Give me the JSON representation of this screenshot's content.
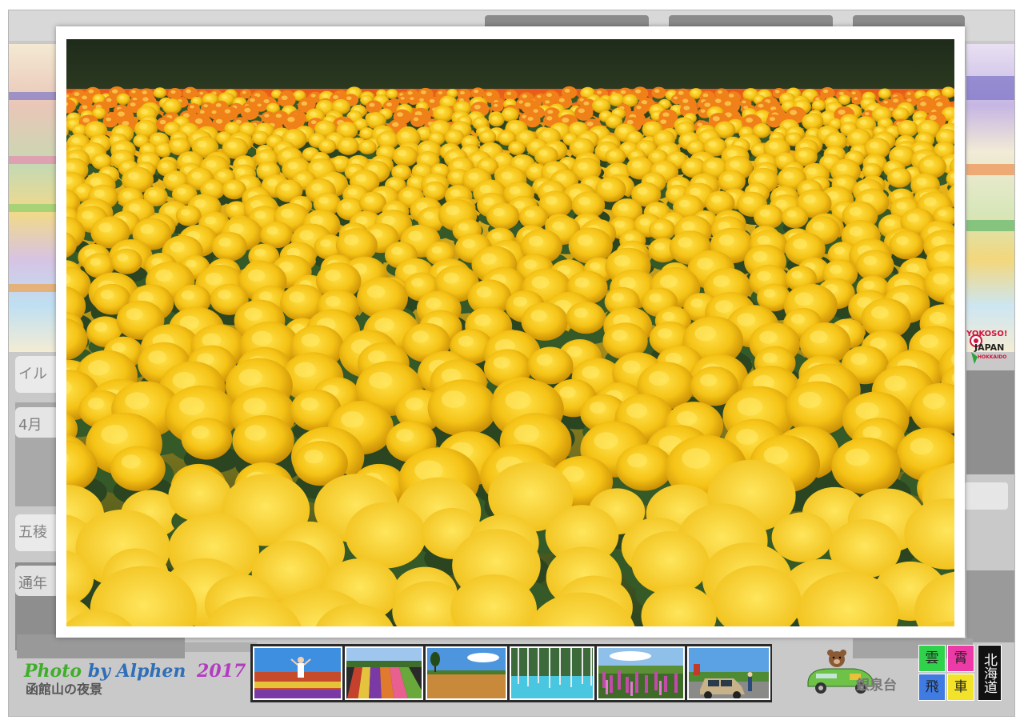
{
  "signature": {
    "photo": "Photo",
    "by": "by Alphen",
    "year": "2017",
    "shadow_text": "函館山の夜景"
  },
  "background": {
    "cards": [
      "イル",
      "4月",
      "五稜",
      "通年"
    ],
    "right_label": "銀泉台"
  },
  "main_photo": {
    "subject": "marigold-field"
  },
  "thumbnails": [
    {
      "name": "person-in-flower-field"
    },
    {
      "name": "striped-flower-fields"
    },
    {
      "name": "wheat-field-with-tree"
    },
    {
      "name": "blue-pond-birch-trees"
    },
    {
      "name": "lupine-field"
    },
    {
      "name": "car-on-road"
    }
  ],
  "badge": {
    "cells": [
      "雲",
      "霄",
      "飛",
      "車"
    ],
    "vertical": "北海道"
  },
  "logo": {
    "line1": "YOKOSO!",
    "line2": "JAPAN",
    "line3": "HOKKAIDO"
  },
  "colors": {
    "marigold": "#f2c21a",
    "marigold_dark": "#d69b08",
    "foliage": "#2f4a22",
    "sig_green": "#3fae2a",
    "sig_blue": "#2f6fb7",
    "sig_purple": "#b23cc0"
  }
}
